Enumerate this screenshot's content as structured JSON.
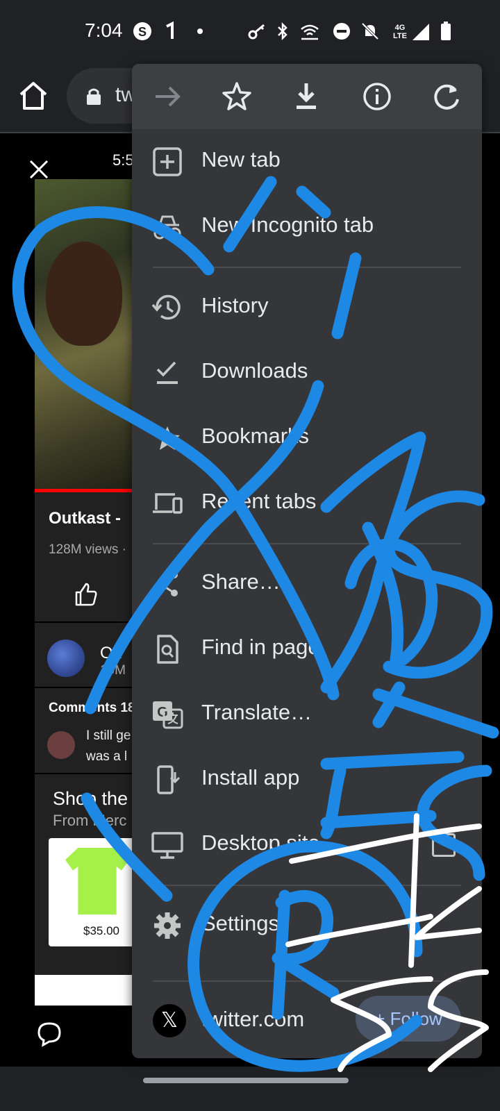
{
  "status_bar": {
    "time": "7:04",
    "icons": [
      "skype-icon",
      "sim-signal-icon",
      "dot-icon",
      "key-icon",
      "bluetooth-icon",
      "wifi-calling-icon",
      "do-not-disturb-icon",
      "notifications-off-icon",
      "lte-signal-icon",
      "battery-icon"
    ],
    "network": "4G LTE"
  },
  "toolbar": {
    "url_text": "tw"
  },
  "page": {
    "video_time": "5:5",
    "video_title": "Outkast - ",
    "video_views": "128M views · ",
    "channel_name": "Ou",
    "channel_subs": "19M",
    "comments_label": "Comments 18",
    "comment_line1": "I still ge",
    "comment_line2": "was a l",
    "shop_title": "Shop the ",
    "shop_sub": "From Merc",
    "product_price": "$35.00"
  },
  "menu": {
    "top_actions": [
      "forward-icon",
      "bookmark-star-icon",
      "download-icon",
      "info-icon",
      "reload-icon"
    ],
    "items": [
      {
        "label": "New tab",
        "icon": "new-tab-icon"
      },
      {
        "label": "New Incognito tab",
        "icon": "incognito-icon"
      },
      {
        "label": "History",
        "icon": "history-icon"
      },
      {
        "label": "Downloads",
        "icon": "downloads-icon"
      },
      {
        "label": "Bookmarks",
        "icon": "bookmarks-icon"
      },
      {
        "label": "Recent tabs",
        "icon": "recent-tabs-icon"
      },
      {
        "label": "Share…",
        "icon": "share-icon"
      },
      {
        "label": "Find in page",
        "icon": "find-in-page-icon"
      },
      {
        "label": "Translate…",
        "icon": "translate-icon"
      },
      {
        "label": "Install app",
        "icon": "install-app-icon"
      },
      {
        "label": "Desktop site",
        "icon": "desktop-icon",
        "checkbox": false
      },
      {
        "label": "Settings",
        "icon": "settings-icon"
      }
    ],
    "footer": {
      "site": "twitter.com",
      "follow_label": "+ Follow"
    }
  },
  "colors": {
    "menu_background": "#35363a",
    "accent": "#a8c7fa",
    "scribble_blue": "#1e88e5"
  }
}
